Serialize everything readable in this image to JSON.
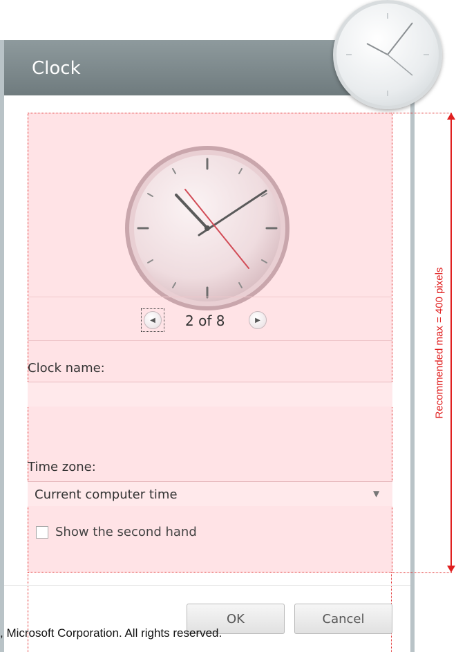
{
  "window": {
    "title": "Clock"
  },
  "pager": {
    "text": "2 of 8"
  },
  "clock_name": {
    "label": "Clock name:",
    "value": ""
  },
  "time_zone": {
    "label": "Time zone:",
    "selected": "Current computer time"
  },
  "second_hand": {
    "label": "Show the second hand",
    "checked": false
  },
  "buttons": {
    "ok": "OK",
    "cancel": "Cancel"
  },
  "annotation": {
    "measure_label": "Recommended max = 400 pixels",
    "color": "#e02020"
  },
  "footer": {
    "copyright": ", Microsoft Corporation. All rights reserved."
  }
}
